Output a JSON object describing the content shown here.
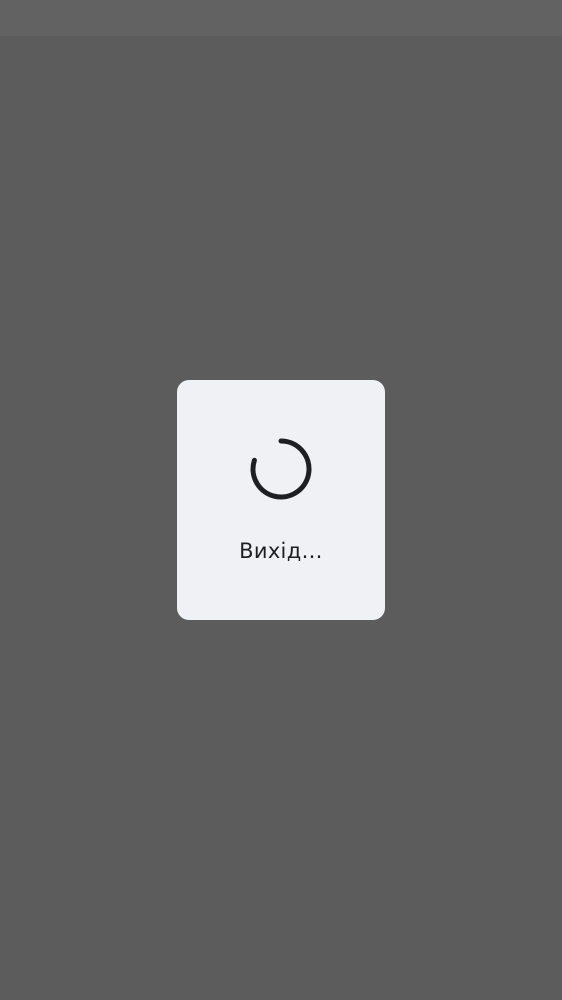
{
  "dialog": {
    "message": "Вихід…"
  },
  "spinner": {
    "icon": "loading-spinner-icon",
    "color": "#1e1f22"
  },
  "colors": {
    "scrim": "#5c5c5c",
    "dialog_background": "#f0f1f5",
    "text": "#1f1f22"
  }
}
